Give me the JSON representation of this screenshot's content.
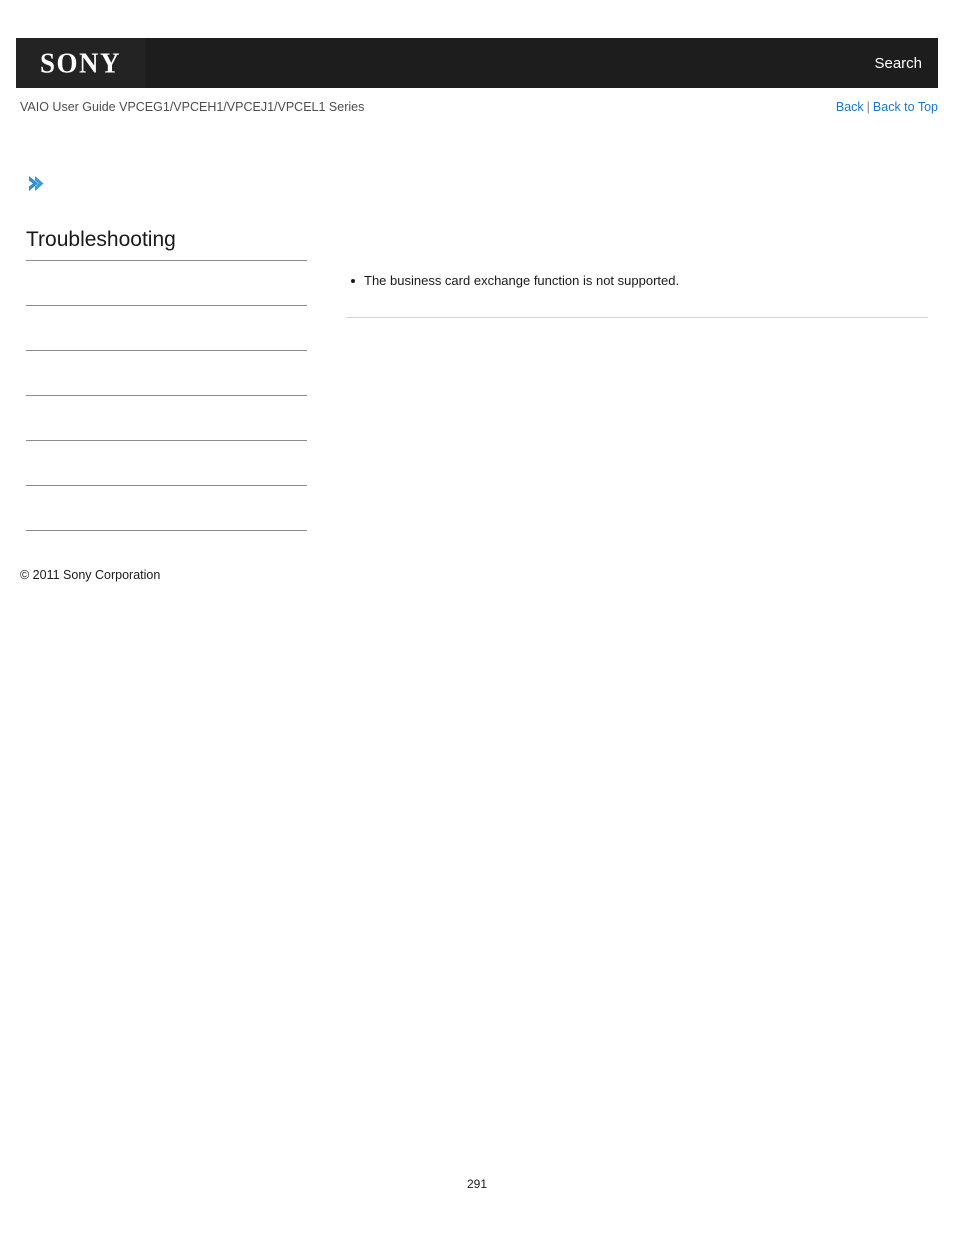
{
  "header": {
    "logo_text": "SONY",
    "search_label": "Search"
  },
  "subheader": {
    "guide_title": "VAIO User Guide VPCEG1/VPCEH1/VPCEJ1/VPCEL1 Series",
    "back_label": "Back",
    "separator": "|",
    "back_to_top_label": "Back to Top"
  },
  "breadcrumb": {
    "chevron_icon": "chevron-right-icon",
    "label": ""
  },
  "sidebar": {
    "heading": "Troubleshooting",
    "items": [
      {
        "label": ""
      },
      {
        "label": ""
      },
      {
        "label": ""
      },
      {
        "label": ""
      },
      {
        "label": ""
      },
      {
        "label": ""
      }
    ]
  },
  "content": {
    "bullets": [
      "The business card exchange function is not supported."
    ]
  },
  "footer": {
    "copyright": "© 2011 Sony Corporation",
    "page_number": "291"
  },
  "colors": {
    "header_bg": "#1d1d1d",
    "logo_block_bg": "#232323",
    "link_blue": "#1976d2",
    "chevron_blue": "#2f8fd0",
    "rule_gray": "#8c8c8c",
    "content_rule_gray": "#d4d4d4",
    "subtitle_gray": "#4d4d4d"
  }
}
